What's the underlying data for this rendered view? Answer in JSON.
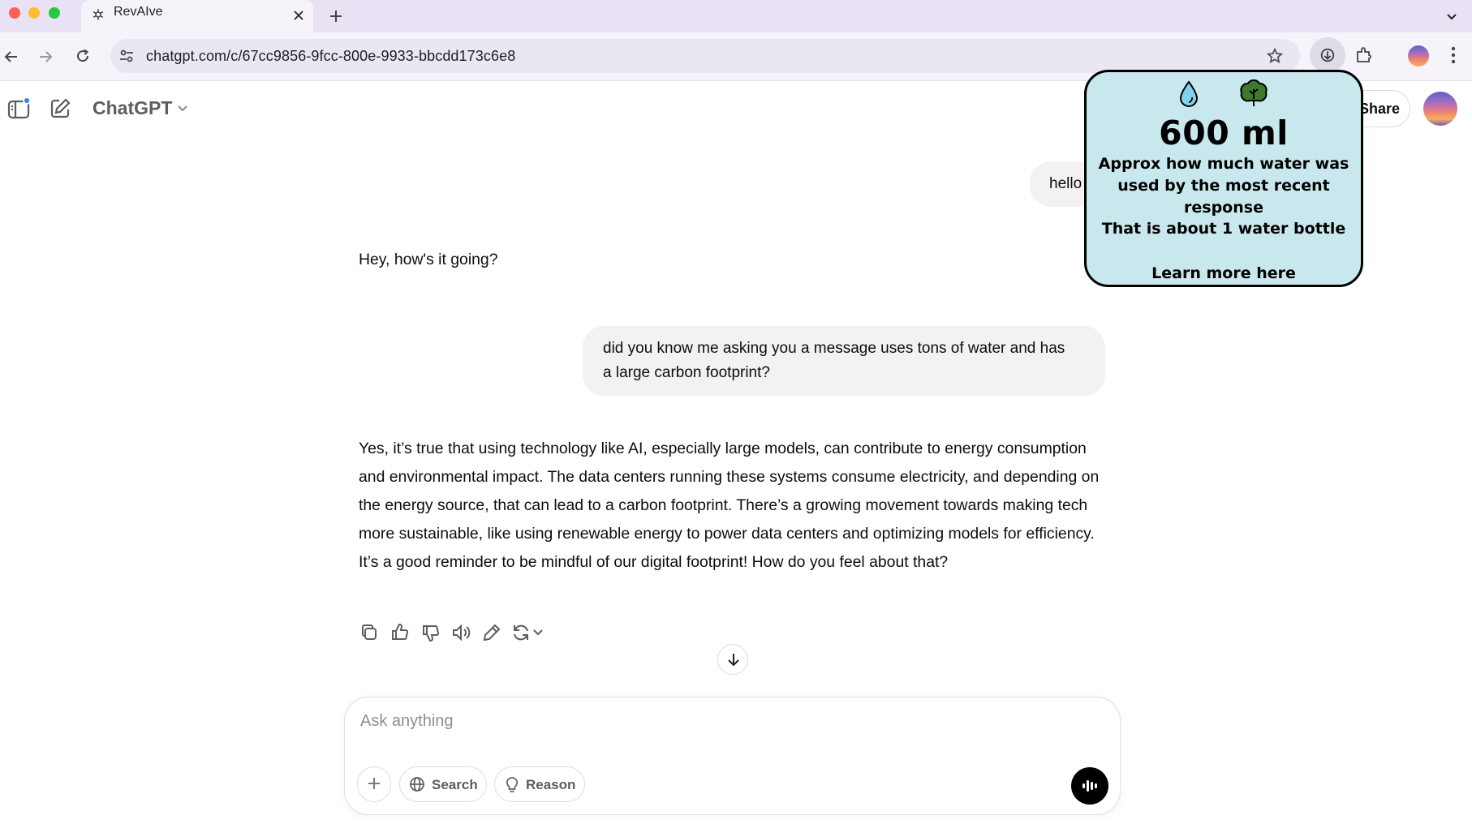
{
  "browser": {
    "tab_title": "RevAIve",
    "url": "chatgpt.com/c/67cc9856-9fcc-800e-9933-bbcdd173c6e8"
  },
  "app": {
    "title": "ChatGPT",
    "share_label": "Share"
  },
  "conversation": [
    {
      "role": "user",
      "text": "hello"
    },
    {
      "role": "assistant",
      "text": "Hey, how's it going?"
    },
    {
      "role": "user",
      "text": "did you know me asking you a message uses tons of water and has a large carbon footprint?"
    },
    {
      "role": "assistant",
      "text": "Yes, it’s true that using technology like AI, especially large models, can contribute to energy consumption and environmental impact. The data centers running these systems consume electricity, and depending on the energy source, that can lead to a carbon footprint. There’s a growing movement towards making tech more sustainable, like using renewable energy to power data centers and optimizing models for efficiency. It’s a good reminder to be mindful of our digital footprint! How do you feel about that?"
    }
  ],
  "composer": {
    "placeholder": "Ask anything",
    "search_label": "Search",
    "reason_label": "Reason"
  },
  "extension_popup": {
    "amount": "600 ml",
    "description": "Approx how much water was used by the most recent response",
    "equivalent": "That is about 1 water bottle",
    "link_text": "Learn more here",
    "icons": [
      "water-drop-icon",
      "tree-icon"
    ],
    "background_color": "#c8e8ee"
  },
  "colors": {
    "tabbar": "#e8e2f4",
    "toolbar": "#f6f3fb",
    "user_bubble": "#f2f2f2"
  }
}
